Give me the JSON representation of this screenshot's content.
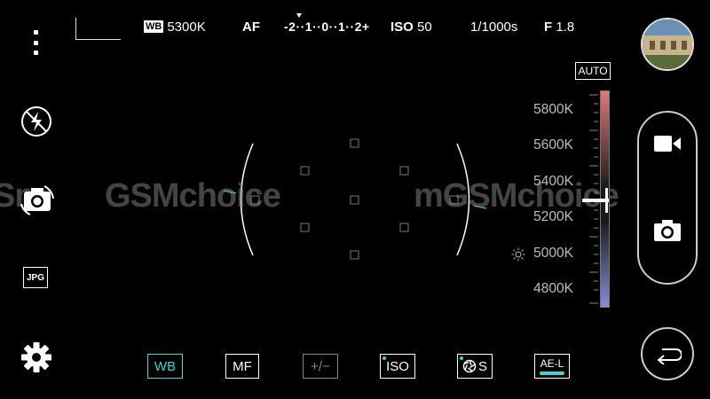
{
  "status_bar": {
    "wb_badge": "WB",
    "wb_value": "5300K",
    "focus_mode": "AF",
    "ev_scale": "-2··1··0··1··2+",
    "iso_label": "ISO",
    "iso_value": "50",
    "shutter": "1/1000s",
    "aperture_label": "F",
    "aperture_value": "1.8"
  },
  "watermark": {
    "left": "GSMchoice",
    "left_cut": "Sm",
    "right": "mGSMchoice"
  },
  "toolbar": {
    "wb": "WB",
    "mf": "MF",
    "exposure": "+/−",
    "iso": "ISO",
    "shutter": "S",
    "ae_lock": "AE-L"
  },
  "left_column": {
    "format": "JPG"
  },
  "wb_slider": {
    "auto_label": "AUTO",
    "labels": [
      "5800K",
      "5600K",
      "5400K",
      "5200K",
      "5000K",
      "4800K"
    ],
    "selected_value": "5300K"
  },
  "colors": {
    "accent": "#3ad5d5",
    "focus_arc": "#ffffff",
    "level_marker": "#22cc44"
  }
}
